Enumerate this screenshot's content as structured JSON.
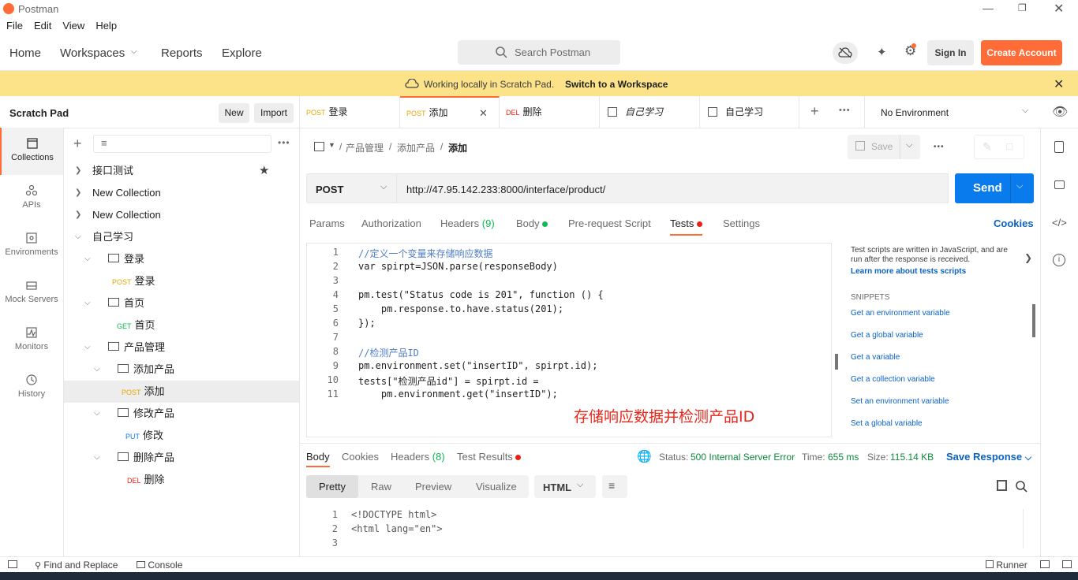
{
  "window": {
    "title": "Postman"
  },
  "menu": [
    "File",
    "Edit",
    "View",
    "Help"
  ],
  "header": {
    "home": "Home",
    "workspaces": "Workspaces",
    "reports": "Reports",
    "explore": "Explore",
    "search_placeholder": "Search Postman",
    "sign_in": "Sign In",
    "create_account": "Create Account"
  },
  "banner": {
    "text": "Working locally in Scratch Pad.",
    "link": "Switch to a Workspace"
  },
  "sidebar": {
    "title": "Scratch Pad",
    "new": "New",
    "import": "Import",
    "nav": [
      {
        "label": "Collections",
        "icon": "collections-icon"
      },
      {
        "label": "APIs",
        "icon": "apis-icon"
      },
      {
        "label": "Environments",
        "icon": "environments-icon"
      },
      {
        "label": "Mock Servers",
        "icon": "mock-servers-icon"
      },
      {
        "label": "Monitors",
        "icon": "monitors-icon"
      },
      {
        "label": "History",
        "icon": "history-icon"
      }
    ],
    "tree": [
      {
        "label": "接口测试"
      },
      {
        "label": "New Collection"
      },
      {
        "label": "New Collection"
      },
      {
        "label": "自己学习"
      },
      {
        "label": "登录"
      },
      {
        "method": "POST",
        "label": "登录"
      },
      {
        "label": "首页"
      },
      {
        "method": "GET",
        "label": "首页"
      },
      {
        "label": "产品管理"
      },
      {
        "label": "添加产品"
      },
      {
        "method": "POST",
        "label": "添加"
      },
      {
        "label": "修改产品"
      },
      {
        "method": "PUT",
        "label": "修改"
      },
      {
        "label": "删除产品"
      },
      {
        "method": "DEL",
        "label": "删除"
      }
    ]
  },
  "tabs": [
    {
      "method": "POST",
      "label": "登录"
    },
    {
      "method": "POST",
      "label": "添加"
    },
    {
      "method": "DEL",
      "label": "删除"
    },
    {
      "label": "自己学习"
    },
    {
      "label": "自己学习"
    }
  ],
  "environment": "No Environment",
  "breadcrumb": [
    "产品管理",
    "添加产品",
    "添加"
  ],
  "save": "Save",
  "request": {
    "method": "POST",
    "url": "http://47.95.142.233:8000/interface/product/",
    "send": "Send"
  },
  "req_tabs": [
    {
      "label": "Params"
    },
    {
      "label": "Authorization"
    },
    {
      "label": "Headers",
      "count": "(9)"
    },
    {
      "label": "Body"
    },
    {
      "label": "Pre-request Script"
    },
    {
      "label": "Tests"
    },
    {
      "label": "Settings"
    }
  ],
  "cookies": "Cookies",
  "code": [
    {
      "n": "1",
      "t": "//定义一个变量来存储响应数据"
    },
    {
      "n": "2",
      "t": "var spirpt=JSON.parse(responseBody)"
    },
    {
      "n": "3",
      "t": ""
    },
    {
      "n": "4",
      "t": "pm.test(\"Status code is 201\", function () {"
    },
    {
      "n": "5",
      "t": "    pm.response.to.have.status(201);"
    },
    {
      "n": "6",
      "t": "});"
    },
    {
      "n": "7",
      "t": ""
    },
    {
      "n": "8",
      "t": "//检测产品ID"
    },
    {
      "n": "9",
      "t": "pm.environment.set(\"insertID\", spirpt.id);"
    },
    {
      "n": "10",
      "t": "tests[\"检测产品id\"] = spirpt.id ="
    },
    {
      "n": "11",
      "t": "    pm.environment.get(\"insertID\");"
    }
  ],
  "annotation": "存储响应数据并检测产品ID",
  "snippets_panel": {
    "intro": "Test scripts are written in JavaScript, and are run after the response is received.",
    "learn": "Learn more about tests scripts",
    "heading": "SNIPPETS",
    "items": [
      "Get an environment variable",
      "Get a global variable",
      "Get a variable",
      "Get a collection variable",
      "Set an environment variable",
      "Set a global variable"
    ]
  },
  "response": {
    "tabs": [
      {
        "label": "Body"
      },
      {
        "label": "Cookies"
      },
      {
        "label": "Headers",
        "count": "(8)"
      },
      {
        "label": "Test Results"
      }
    ],
    "status_label": "Status:",
    "status": "500 Internal Server Error",
    "time_label": "Time:",
    "time": "655 ms",
    "size_label": "Size:",
    "size": "115.14 KB",
    "save_response": "Save Response",
    "views": [
      "Pretty",
      "Raw",
      "Preview",
      "Visualize"
    ],
    "format": "HTML",
    "code": [
      {
        "n": "1",
        "t": "<!DOCTYPE html>"
      },
      {
        "n": "2",
        "t": "<html lang=\"en\">"
      },
      {
        "n": "3",
        "t": ""
      }
    ]
  },
  "statusbar": {
    "find": "Find and Replace",
    "console": "Console",
    "runner": "Runner"
  }
}
